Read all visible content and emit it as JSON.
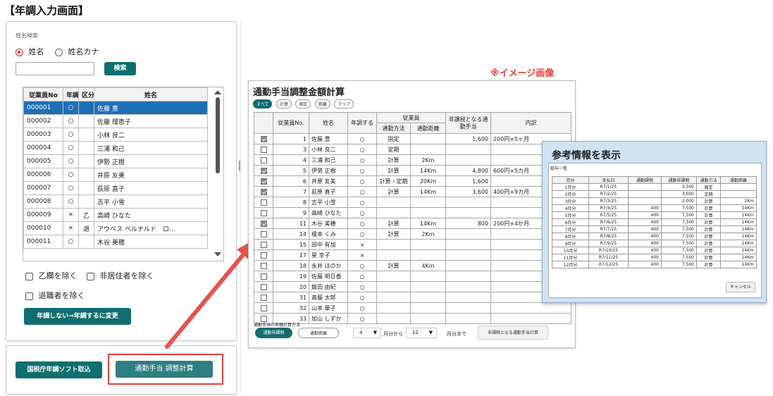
{
  "page_title": "【年調入力画面】",
  "image_note": "※イメージ画像",
  "search": {
    "section_label": "姓名検索",
    "radio_name": "姓名",
    "radio_kana": "姓名カナ",
    "input_value": "",
    "search_button": "検索"
  },
  "employee_table": {
    "headers": [
      "従業員No",
      "年調",
      "区分",
      "姓名"
    ],
    "rows": [
      {
        "no": "000001",
        "nencho": "○",
        "kubun": "",
        "name": "佐藤 豊",
        "selected": true
      },
      {
        "no": "000002",
        "nencho": "○",
        "kubun": "",
        "name": "佐藤 理恵子"
      },
      {
        "no": "000003",
        "nencho": "○",
        "kubun": "",
        "name": "小林 良二"
      },
      {
        "no": "000004",
        "nencho": "○",
        "kubun": "",
        "name": "三浦 和己"
      },
      {
        "no": "000005",
        "nencho": "○",
        "kubun": "",
        "name": "伊勢 正樹"
      },
      {
        "no": "000006",
        "nencho": "○",
        "kubun": "",
        "name": "井原 友美"
      },
      {
        "no": "000007",
        "nencho": "○",
        "kubun": "",
        "name": "荻原 直子"
      },
      {
        "no": "000008",
        "nencho": "○",
        "kubun": "",
        "name": "志平 小雪"
      },
      {
        "no": "000009",
        "nencho": "×",
        "kubun": "乙",
        "name": "高崎 ひなた"
      },
      {
        "no": "000010",
        "nencho": "×",
        "kubun": "退",
        "name": "アウベス ベルナルド　ロ..."
      },
      {
        "no": "000011",
        "nencho": "○",
        "kubun": "",
        "name": "木谷 美穂"
      }
    ]
  },
  "filters": {
    "exclude_otsu": "乙欄を除く",
    "exclude_nonresident": "非居住者を除く",
    "exclude_retired": "退職者を除く"
  },
  "change_button": "年調しない→年調するに変更",
  "import_button": "国税庁年調ソフト取込",
  "calc_button": "通勤手当 調整計算",
  "calc_window": {
    "title": "通勤手当調整金額計算",
    "chips": [
      "すべて",
      "計算",
      "固定",
      "距離",
      "クリア"
    ],
    "headers": {
      "emp_no": "従業員No.",
      "name": "姓名",
      "nencho": "年調する",
      "employee": "従業員",
      "method": "通勤方法",
      "distance": "通勤距離",
      "nontax": "非課税となる通勤手当",
      "detail": "内訳"
    },
    "rows": [
      {
        "checked": true,
        "no": "1",
        "name": "佐藤 豊",
        "nencho": "○",
        "method": "固定",
        "distance": "",
        "nontax": "1,600",
        "detail": "200円×5ヶ月"
      },
      {
        "checked": false,
        "no": "3",
        "name": "小林 良二",
        "nencho": "○",
        "method": "定期",
        "distance": "",
        "nontax": "",
        "detail": ""
      },
      {
        "checked": false,
        "no": "4",
        "name": "三浦 和己",
        "nencho": "○",
        "method": "計算",
        "distance": "2Km",
        "nontax": "",
        "detail": ""
      },
      {
        "checked": true,
        "no": "5",
        "name": "伊勢 正樹",
        "nencho": "○",
        "method": "計算",
        "distance": "14Km",
        "nontax": "4,800",
        "detail": "600円×5カ月"
      },
      {
        "checked": true,
        "no": "6",
        "name": "井原 友美",
        "nencho": "○",
        "method": "計算・定期",
        "distance": "20Km",
        "nontax": "1,600",
        "detail": ""
      },
      {
        "checked": true,
        "no": "7",
        "name": "荻原 直子",
        "nencho": "○",
        "method": "計算",
        "distance": "14Km",
        "nontax": "3,600",
        "detail": "400円×9カ月"
      },
      {
        "checked": false,
        "no": "8",
        "name": "志平 小雪",
        "nencho": "○",
        "method": "",
        "distance": "",
        "nontax": "",
        "detail": ""
      },
      {
        "checked": false,
        "no": "9",
        "name": "高崎 ひなた",
        "nencho": "○",
        "method": "",
        "distance": "",
        "nontax": "",
        "detail": ""
      },
      {
        "checked": true,
        "no": "11",
        "name": "木谷 美穂",
        "nencho": "○",
        "method": "計算",
        "distance": "14Km",
        "nontax": "800",
        "detail": "200円×4か月"
      },
      {
        "checked": false,
        "no": "14",
        "name": "榎本 くみ",
        "nencho": "○",
        "method": "計算",
        "distance": "2Km",
        "nontax": "",
        "detail": ""
      },
      {
        "checked": false,
        "no": "15",
        "name": "田中 有加",
        "nencho": "×",
        "method": "",
        "distance": "",
        "nontax": "",
        "detail": ""
      },
      {
        "checked": false,
        "no": "17",
        "name": "星 幸子",
        "nencho": "×",
        "method": "",
        "distance": "",
        "nontax": "",
        "detail": ""
      },
      {
        "checked": false,
        "no": "18",
        "name": "永井 ほのか",
        "nencho": "○",
        "method": "計算",
        "distance": "4Km",
        "nontax": "",
        "detail": ""
      },
      {
        "checked": false,
        "no": "19",
        "name": "佐藤 明日香",
        "nencho": "○",
        "method": "",
        "distance": "",
        "nontax": "",
        "detail": ""
      },
      {
        "checked": false,
        "no": "20",
        "name": "飯田 由紀",
        "nencho": "○",
        "method": "",
        "distance": "",
        "nontax": "",
        "detail": ""
      },
      {
        "checked": false,
        "no": "31",
        "name": "斎藤 太郎",
        "nencho": "○",
        "method": "",
        "distance": "",
        "nontax": "",
        "detail": ""
      },
      {
        "checked": false,
        "no": "32",
        "name": "山本 華子",
        "nencho": "○",
        "method": "",
        "distance": "",
        "nontax": "",
        "detail": ""
      },
      {
        "checked": false,
        "no": "33",
        "name": "加山 しずか",
        "nencho": "○",
        "method": "",
        "distance": "",
        "nontax": "",
        "detail": ""
      }
    ],
    "footer": {
      "label": "通勤手当の差額計算方法",
      "btn_nontax": "通勤非課税",
      "btn_distance": "通勤距離",
      "from_month": "4",
      "from_suffix": "月分から",
      "to_month": "12",
      "to_suffix": "月分まで",
      "calc_button": "非課税となる通勤手当計算"
    }
  },
  "ref_popup": {
    "title": "参考情報を表示",
    "subtitle": "給与一覧",
    "headers": [
      "月分",
      "支払日",
      "通勤課税",
      "通勤非課税",
      "通勤方法",
      "通勤距離"
    ],
    "rows": [
      [
        "1月分",
        "R7/1/25",
        "",
        "3,500",
        "固定",
        ""
      ],
      [
        "2月分",
        "R7/2/25",
        "",
        "3,000",
        "定期",
        ""
      ],
      [
        "3月分",
        "R7/3/25",
        "",
        "2,000",
        "計算",
        "2Km"
      ],
      [
        "4月分",
        "R7/4/25",
        "400",
        "7,500",
        "計算",
        "14Km"
      ],
      [
        "5月分",
        "R7/5/25",
        "400",
        "7,500",
        "計算",
        "14Km"
      ],
      [
        "6月分",
        "R7/6/25",
        "400",
        "7,500",
        "計算",
        "14Km"
      ],
      [
        "7月分",
        "R7/7/25",
        "400",
        "7,500",
        "計算",
        "14Km"
      ],
      [
        "8月分",
        "R7/8/25",
        "400",
        "7,500",
        "計算",
        "14Km"
      ],
      [
        "9月分",
        "R7/9/25",
        "400",
        "7,500",
        "計算",
        "14Km"
      ],
      [
        "10月分",
        "R7/10/25",
        "400",
        "7,500",
        "計算",
        "14Km"
      ],
      [
        "11月分",
        "R7/11/25",
        "400",
        "7,500",
        "計算",
        "14Km"
      ],
      [
        "12月分",
        "R7/12/25",
        "400",
        "7,500",
        "計算",
        "14Km"
      ]
    ],
    "cancel_button": "キャンセル"
  },
  "colors": {
    "teal": "#0f6e70",
    "selected_row": "#1d6fb8",
    "highlight_red": "#e0423c",
    "popup_bg": "#cfe3f5"
  }
}
